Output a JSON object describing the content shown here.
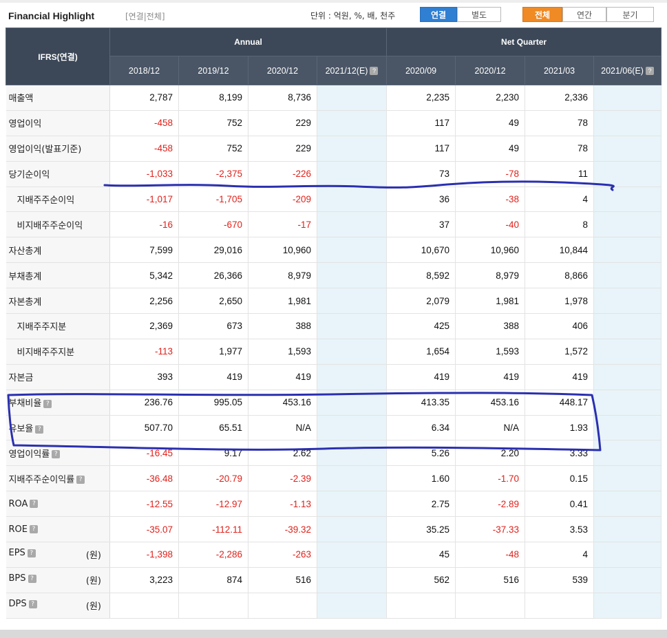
{
  "title": "Financial Highlight",
  "subtitle": "[연결|전체]",
  "unit_text": "단위 : 억원, %, 배, 천주",
  "toggles": {
    "consolidated": "연결",
    "separate": "별도",
    "all": "전체",
    "annual": "연간",
    "quarter": "분기"
  },
  "table": {
    "corner_label": "IFRS(연결)",
    "annual_header": "Annual",
    "quarter_header": "Net Quarter",
    "annual_cols": [
      "2018/12",
      "2019/12",
      "2020/12",
      "2021/12(E)"
    ],
    "quarter_cols": [
      "2020/09",
      "2020/12",
      "2021/03",
      "2021/06(E)"
    ],
    "rows": [
      {
        "label": "매출액",
        "annual": [
          "2,787",
          "8,199",
          "8,736",
          ""
        ],
        "quarter": [
          "2,235",
          "2,230",
          "2,336",
          ""
        ]
      },
      {
        "label": "영업이익",
        "annual": [
          "-458",
          "752",
          "229",
          ""
        ],
        "quarter": [
          "117",
          "49",
          "78",
          ""
        ]
      },
      {
        "label": "영업이익(발표기준)",
        "annual": [
          "-458",
          "752",
          "229",
          ""
        ],
        "quarter": [
          "117",
          "49",
          "78",
          ""
        ]
      },
      {
        "label": "당기순이익",
        "annual": [
          "-1,033",
          "-2,375",
          "-226",
          ""
        ],
        "quarter": [
          "73",
          "-78",
          "11",
          ""
        ]
      },
      {
        "label": "지배주주순이익",
        "annual": [
          "-1,017",
          "-1,705",
          "-209",
          ""
        ],
        "quarter": [
          "36",
          "-38",
          "4",
          ""
        ]
      },
      {
        "label": "비지배주주순이익",
        "annual": [
          "-16",
          "-670",
          "-17",
          ""
        ],
        "quarter": [
          "37",
          "-40",
          "8",
          ""
        ]
      },
      {
        "label": "자산총계",
        "annual": [
          "7,599",
          "29,016",
          "10,960",
          ""
        ],
        "quarter": [
          "10,670",
          "10,960",
          "10,844",
          ""
        ]
      },
      {
        "label": "부채총계",
        "annual": [
          "5,342",
          "26,366",
          "8,979",
          ""
        ],
        "quarter": [
          "8,592",
          "8,979",
          "8,866",
          ""
        ]
      },
      {
        "label": "자본총계",
        "annual": [
          "2,256",
          "2,650",
          "1,981",
          ""
        ],
        "quarter": [
          "2,079",
          "1,981",
          "1,978",
          ""
        ]
      },
      {
        "label": "지배주주지분",
        "annual": [
          "2,369",
          "673",
          "388",
          ""
        ],
        "quarter": [
          "425",
          "388",
          "406",
          ""
        ]
      },
      {
        "label": "비지배주주지분",
        "annual": [
          "-113",
          "1,977",
          "1,593",
          ""
        ],
        "quarter": [
          "1,654",
          "1,593",
          "1,572",
          ""
        ]
      },
      {
        "label": "자본금",
        "annual": [
          "393",
          "419",
          "419",
          ""
        ],
        "quarter": [
          "419",
          "419",
          "419",
          ""
        ]
      },
      {
        "label": "부채비율",
        "annual": [
          "236.76",
          "995.05",
          "453.16",
          ""
        ],
        "quarter": [
          "413.35",
          "453.16",
          "448.17",
          ""
        ]
      },
      {
        "label": "유보율",
        "annual": [
          "507.70",
          "65.51",
          "N/A",
          ""
        ],
        "quarter": [
          "6.34",
          "N/A",
          "1.93",
          ""
        ]
      },
      {
        "label": "영업이익률",
        "annual": [
          "-16.45",
          "9.17",
          "2.62",
          ""
        ],
        "quarter": [
          "5.26",
          "2.20",
          "3.33",
          ""
        ]
      },
      {
        "label": "지배주주순이익률",
        "annual": [
          "-36.48",
          "-20.79",
          "-2.39",
          ""
        ],
        "quarter": [
          "1.60",
          "-1.70",
          "0.15",
          ""
        ]
      },
      {
        "label": "ROA",
        "annual": [
          "-12.55",
          "-12.97",
          "-1.13",
          ""
        ],
        "quarter": [
          "2.75",
          "-2.89",
          "0.41",
          ""
        ]
      },
      {
        "label": "ROE",
        "annual": [
          "-35.07",
          "-112.11",
          "-39.32",
          ""
        ],
        "quarter": [
          "35.25",
          "-37.33",
          "3.53",
          ""
        ]
      },
      {
        "label": "EPS",
        "unit": "(원)",
        "annual": [
          "-1,398",
          "-2,286",
          "-263",
          ""
        ],
        "quarter": [
          "45",
          "-48",
          "4",
          ""
        ]
      },
      {
        "label": "BPS",
        "unit": "(원)",
        "annual": [
          "3,223",
          "874",
          "516",
          ""
        ],
        "quarter": [
          "562",
          "516",
          "539",
          ""
        ]
      },
      {
        "label": "DPS",
        "unit": "(원)",
        "annual": [
          "",
          "",
          "",
          ""
        ],
        "quarter": [
          "",
          "",
          "",
          ""
        ]
      }
    ]
  },
  "colors": {
    "negative": "#e0201a",
    "header_bg": "#3c4858",
    "estimate_bg": "#e8f4f9",
    "annotation": "#2a2fb0",
    "toggle_blue": "#2f7fd3",
    "toggle_orange": "#f08a24"
  }
}
